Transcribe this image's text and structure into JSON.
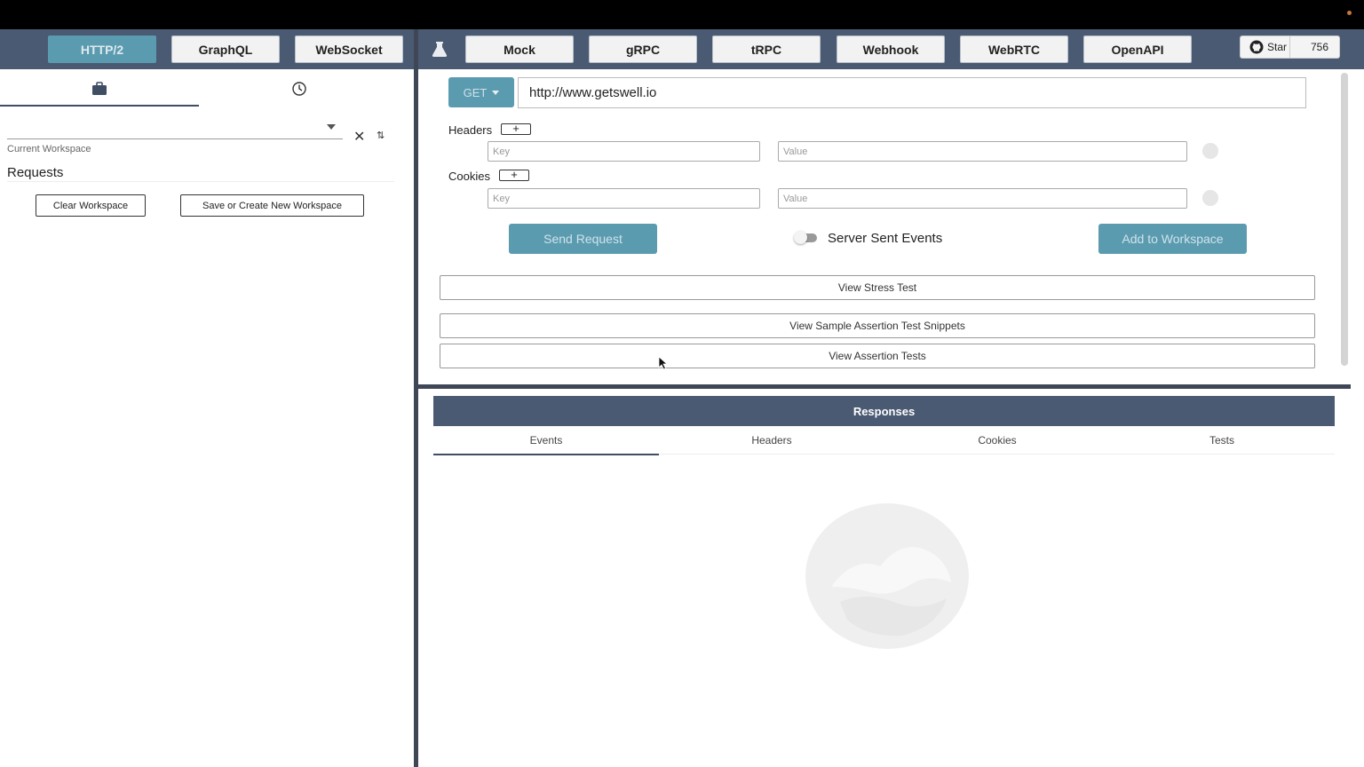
{
  "nav": {
    "tabs": [
      "HTTP/2",
      "GraphQL",
      "WebSocket"
    ],
    "tabs_right": [
      "Mock",
      "gRPC",
      "tRPC",
      "Webhook",
      "WebRTC",
      "OpenAPI"
    ],
    "star_label": "Star",
    "star_count": "756"
  },
  "sidebar": {
    "workspace_label": "Current Workspace",
    "requests_title": "Requests",
    "clear_button": "Clear Workspace",
    "save_button": "Save or Create New Workspace"
  },
  "request": {
    "method": "GET",
    "url": "http://www.getswell.io",
    "headers_label": "Headers",
    "cookies_label": "Cookies",
    "key_placeholder": "Key",
    "value_placeholder": "Value",
    "send_button": "Send Request",
    "sse_label": "Server Sent Events",
    "add_button": "Add to Workspace",
    "stress_button": "View Stress Test",
    "snippets_button": "View Sample Assertion Test Snippets",
    "assertion_button": "View Assertion Tests"
  },
  "responses": {
    "title": "Responses",
    "tabs": [
      "Events",
      "Headers",
      "Cookies",
      "Tests"
    ]
  },
  "colors": {
    "navbar": "#4a5a73",
    "accent": "#5b9bb0",
    "divider": "#3f4757"
  }
}
